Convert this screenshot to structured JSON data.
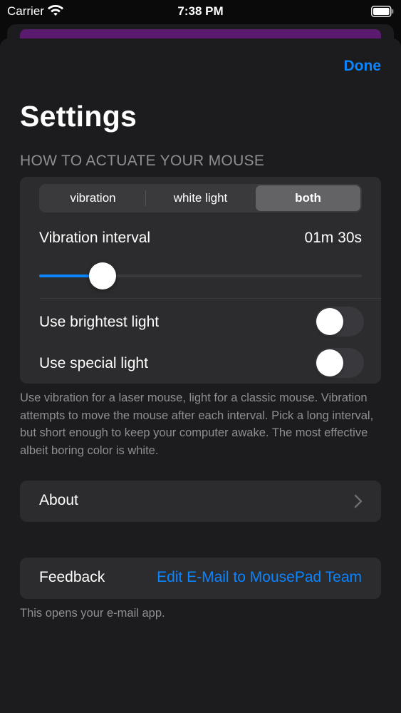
{
  "status_bar": {
    "carrier": "Carrier",
    "time": "7:38 PM"
  },
  "sheet": {
    "done_label": "Done",
    "title": "Settings"
  },
  "actuate": {
    "header": "HOW TO ACTUATE YOUR MOUSE",
    "modes": [
      "vibration",
      "white light",
      "both"
    ],
    "selected_mode": "both",
    "interval_label": "Vibration interval",
    "interval_value": "01m 30s",
    "slider_fraction": 0.155,
    "brightest_label": "Use brightest light",
    "brightest_on": false,
    "special_label": "Use special light",
    "special_on": false,
    "footer": "Use vibration for a laser mouse, light for a classic mouse. Vibration attempts to move the mouse after each interval. Pick a long interval, but short enough to keep your computer awake. The most effective albeit boring color is white."
  },
  "about": {
    "label": "About"
  },
  "feedback": {
    "label": "Feedback",
    "link": "Edit E-Mail to MousePad Team",
    "footer": "This opens your e-mail app."
  },
  "colors": {
    "accent": "#0a84ff",
    "background": "#1c1c1e",
    "cell": "#2c2c2e",
    "secondary_text": "#8e8e93"
  },
  "icons": [
    "wifi-icon",
    "battery-icon",
    "chevron-right-icon"
  ]
}
